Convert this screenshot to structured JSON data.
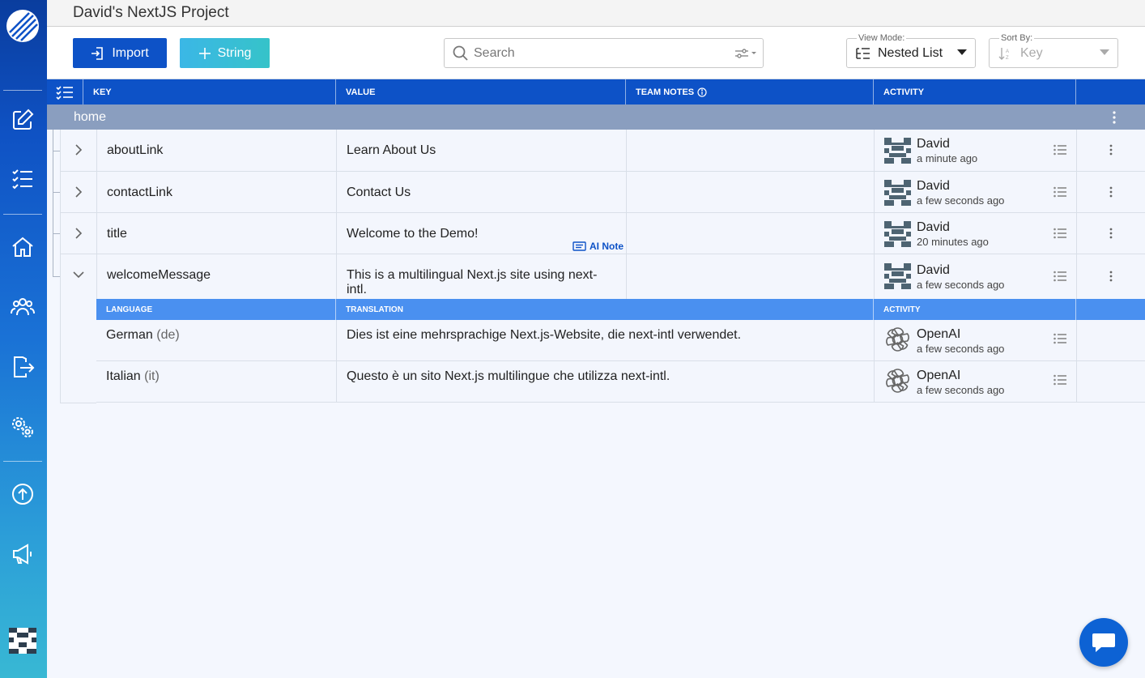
{
  "app": {
    "project_title": "David's NextJS Project"
  },
  "sidebar": {
    "items": [
      {
        "icon": "edit-icon"
      },
      {
        "icon": "checklist-icon"
      },
      {
        "icon": "home-icon"
      },
      {
        "icon": "users-icon"
      },
      {
        "icon": "export-icon"
      },
      {
        "icon": "settings-icon"
      },
      {
        "icon": "upload-icon"
      },
      {
        "icon": "megaphone-icon"
      }
    ]
  },
  "toolbar": {
    "import_label": "Import",
    "string_label": "String",
    "search_placeholder": "Search",
    "view_mode_label": "View Mode:",
    "view_mode_value": "Nested List",
    "sort_by_label": "Sort By:",
    "sort_by_value": "Key"
  },
  "table": {
    "columns": [
      "KEY",
      "VALUE",
      "TEAM NOTES",
      "ACTIVITY"
    ],
    "group": "home",
    "rows": [
      {
        "key": "aboutLink",
        "value": "Learn About Us",
        "note": "",
        "user": "David",
        "time": "a minute ago"
      },
      {
        "key": "contactLink",
        "value": "Contact Us",
        "note": "",
        "user": "David",
        "time": "a few seconds ago"
      },
      {
        "key": "title",
        "value": "Welcome to the Demo!",
        "note": "AI Note",
        "user": "David",
        "time": "20 minutes ago"
      },
      {
        "key": "welcomeMessage",
        "value": "This is a multilingual Next.js site using next-intl.",
        "note": "",
        "user": "David",
        "time": "a few seconds ago"
      }
    ],
    "sub_columns": [
      "LANGUAGE",
      "TRANSLATION",
      "ACTIVITY"
    ],
    "translations": [
      {
        "language": "German",
        "code": "(de)",
        "text": "Dies ist eine mehrsprachige Next.js-Website, die next-intl verwendet.",
        "user": "OpenAI",
        "time": "a few seconds ago"
      },
      {
        "language": "Italian",
        "code": "(it)",
        "text": "Questo è un sito Next.js multilingue che utilizza next-intl.",
        "user": "OpenAI",
        "time": "a few seconds ago"
      }
    ]
  },
  "colors": {
    "primary": "#0d52c7",
    "group": "#8a9ebf",
    "subheader": "#4a90f0"
  }
}
